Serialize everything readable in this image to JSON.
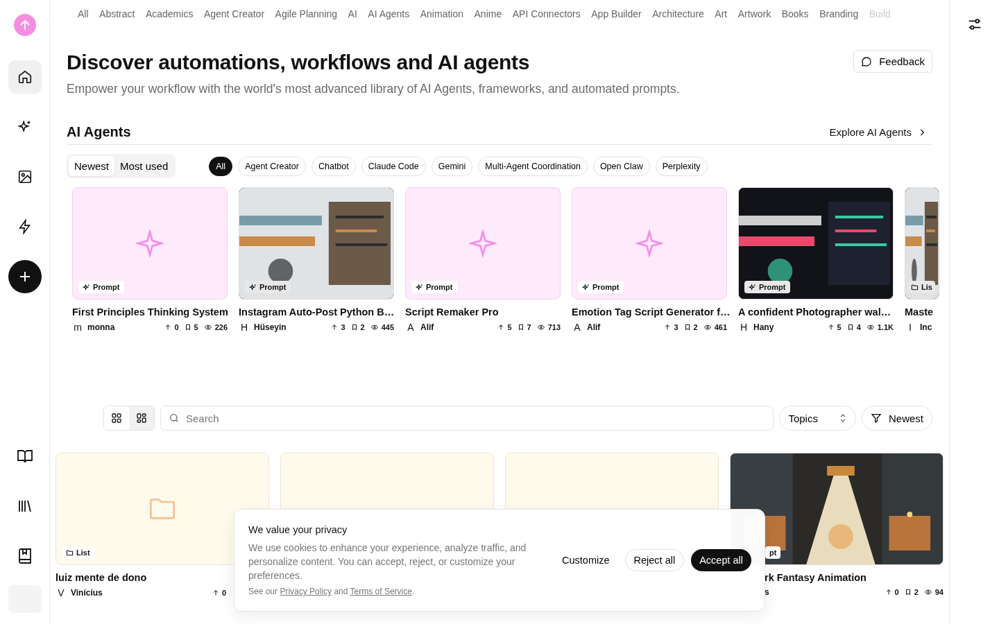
{
  "sidebar": {
    "top_items": [
      {
        "selected": true
      },
      {
        "selected": false
      },
      {
        "selected": false
      },
      {
        "selected": false
      }
    ],
    "bottom_items": [
      {
        "selected": false
      },
      {
        "selected": false
      },
      {
        "selected": false
      }
    ]
  },
  "topics": [
    "All",
    "Abstract",
    "Academics",
    "Agent Creator",
    "Agile Planning",
    "AI",
    "AI Agents",
    "Animation",
    "Anime",
    "API Connectors",
    "App Builder",
    "Architecture",
    "Art",
    "Artwork",
    "Books",
    "Branding",
    "Build"
  ],
  "header": {
    "title": "Discover automations, workflows and AI agents",
    "subtitle": "Empower your workflow with the world's most advanced library of AI Agents, frameworks, and automated prompts.",
    "feedback": "Feedback"
  },
  "section": {
    "title": "AI Agents",
    "link": "Explore AI Agents",
    "sort_tabs": [
      {
        "label": "Newest",
        "selected": true
      },
      {
        "label": "Most used",
        "selected": false
      }
    ],
    "chips": [
      {
        "label": "All",
        "selected": true
      },
      {
        "label": "Agent Creator",
        "selected": false
      },
      {
        "label": "Chatbot",
        "selected": false
      },
      {
        "label": "Claude Code",
        "selected": false
      },
      {
        "label": "Gemini",
        "selected": false
      },
      {
        "label": "Multi-Agent Coordination",
        "selected": false
      },
      {
        "label": "Open Claw",
        "selected": false
      },
      {
        "label": "Perplexity",
        "selected": false
      }
    ],
    "cards": [
      {
        "kind": "placeholder",
        "badge": {
          "kind": "prompt",
          "label": "Prompt"
        },
        "title": "First Principles Thinking System",
        "initial": "m",
        "author": "monna",
        "upvotes": "0",
        "saves": "5",
        "views": "226"
      },
      {
        "kind": "picture",
        "badge": {
          "kind": "prompt",
          "label": "Prompt"
        },
        "title": "Instagram Auto-Post Python B…",
        "initial": "H",
        "author": "Hüseyin",
        "upvotes": "3",
        "saves": "2",
        "views": "445"
      },
      {
        "kind": "placeholder",
        "badge": {
          "kind": "prompt",
          "label": "Prompt"
        },
        "title": "Script Remaker Pro",
        "initial": "A",
        "author": "Alif",
        "upvotes": "5",
        "saves": "7",
        "views": "713"
      },
      {
        "kind": "placeholder",
        "badge": {
          "kind": "prompt",
          "label": "Prompt"
        },
        "title": "Emotion Tag Script Generator f…",
        "initial": "A",
        "author": "Alif",
        "upvotes": "3",
        "saves": "2",
        "views": "461"
      },
      {
        "kind": "picture",
        "badge": {
          "kind": "prompt",
          "label": "Prompt"
        },
        "title": "A confident Photographer wal…",
        "initial": "H",
        "author": "Hany",
        "upvotes": "5",
        "saves": "4",
        "views": "1.1K"
      },
      {
        "kind": "picture",
        "badge": {
          "kind": "list",
          "label": "Lis"
        },
        "title": "Maste",
        "initial": "I",
        "author": "Inc"
      }
    ]
  },
  "toolbar": {
    "views": [
      {
        "selected": false
      },
      {
        "selected": true
      }
    ],
    "search": {
      "placeholder": "Search"
    },
    "topics": "Topics",
    "sort": "Newest"
  },
  "grid": [
    {
      "kind": "placeholder",
      "badge": {
        "kind": "list",
        "label": "List"
      },
      "title": "luiz mente de dono",
      "initial": "V",
      "author": "Vinícius",
      "upvotes": "0"
    },
    {
      "kind": "placeholder"
    },
    {
      "kind": "placeholder"
    },
    {
      "kind": "picture",
      "badge": {
        "kind": "prompt",
        "label": "pt"
      },
      "title": "rk Fantasy Animation",
      "author": "s",
      "upvotes": "0",
      "saves": "2",
      "views": "94"
    }
  ],
  "cookie": {
    "title": "We value your privacy",
    "text": "We use cookies to enhance your experience, analyze traffic, and personalize content. You can accept, reject, or customize your preferences.",
    "see": "See our",
    "privacy": "Privacy Policy",
    "and": "and",
    "terms": "Terms of Service",
    "end": ".",
    "customize": "Customize",
    "reject": "Reject all",
    "accept": "Accept all"
  }
}
